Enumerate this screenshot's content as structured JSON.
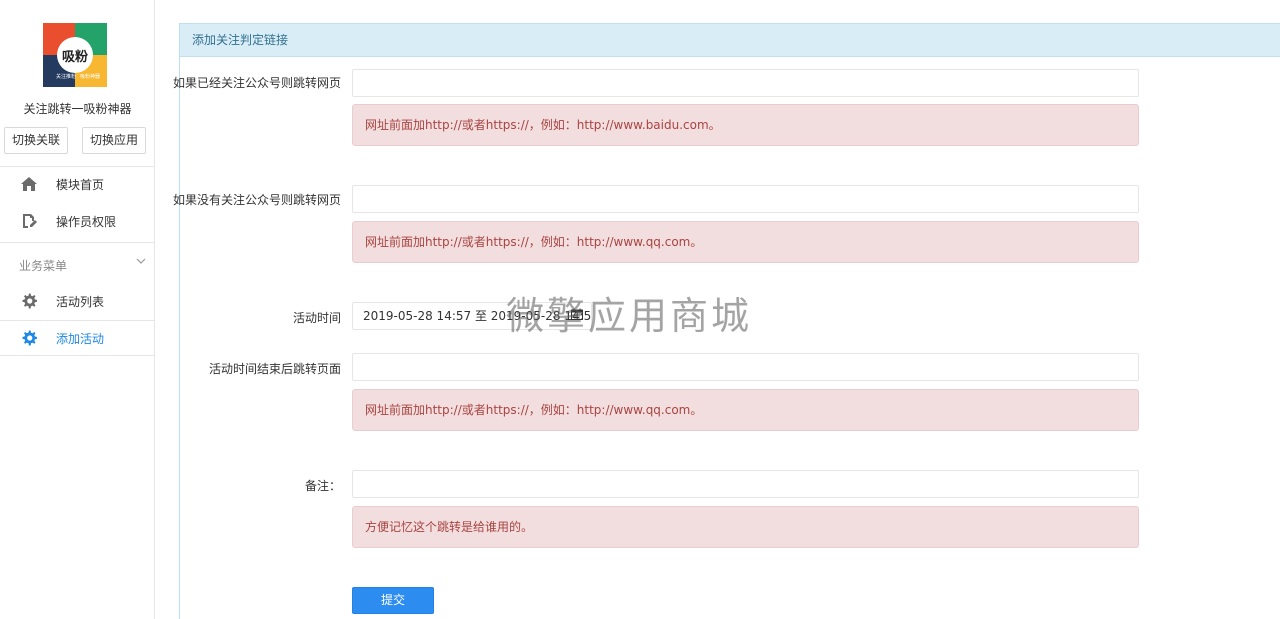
{
  "sidebar": {
    "logo_text": "吸粉",
    "logo_small_left": "关注推粉",
    "logo_small_right": "吸粉神器",
    "app_name": "关注跳转一吸粉神器",
    "switch_link": "切换关联",
    "switch_app": "切换应用",
    "nav_home": "模块首页",
    "nav_perm": "操作员权限",
    "group_title": "业务菜单",
    "nav_list": "活动列表",
    "nav_add": "添加活动"
  },
  "panel": {
    "title": "添加关注判定链接",
    "followed_label": "如果已经关注公众号则跳转网页",
    "followed_value": "",
    "followed_hint": "网址前面加http://或者https://，例如：http://www.baidu.com。",
    "unfollowed_label": "如果没有关注公众号则跳转网页",
    "unfollowed_value": "",
    "unfollowed_hint": "网址前面加http://或者https://，例如：http://www.qq.com。",
    "time_label": "活动时间",
    "time_value": "2019-05-28 14:57 至 2019-05-28 14:57",
    "end_label": "活动时间结束后跳转页面",
    "end_value": "",
    "end_hint": "网址前面加http://或者https://，例如：http://www.qq.com。",
    "note_label": "备注：",
    "note_value": "",
    "note_hint": "方便记忆这个跳转是给谁用的。",
    "submit": "提交"
  },
  "watermark": "微擎应用商城",
  "colors": {
    "accent": "#2d8cf0",
    "active_nav": "#1e88e5",
    "header_bg": "#d9edf7",
    "alert_bg": "#f2dede",
    "alert_text": "#a94442"
  }
}
